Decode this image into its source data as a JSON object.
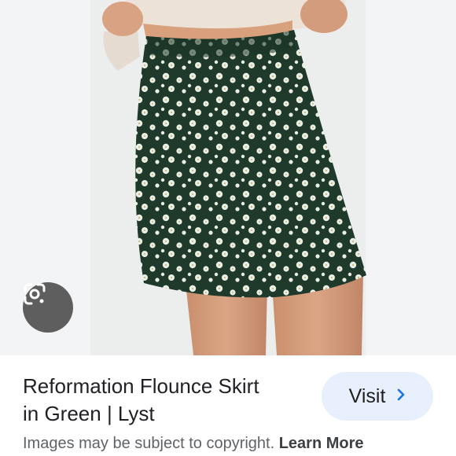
{
  "product": {
    "title_line1": "Reformation Flounce Skirt",
    "title_line2": "in Green | Lyst"
  },
  "actions": {
    "visit_label": "Visit"
  },
  "footer": {
    "copyright_text": "Images may be subject to copyright.",
    "learn_more_label": "Learn More"
  },
  "icons": {
    "lens": "google-lens-icon",
    "chevron": "chevron-right-icon"
  },
  "colors": {
    "skirt_green": "#1f3a2b",
    "flower_white": "#e9efe6",
    "visit_bg": "#e8f0fe",
    "chevron_blue": "#1a73e8",
    "lens_bg": "#5e5e5e"
  }
}
